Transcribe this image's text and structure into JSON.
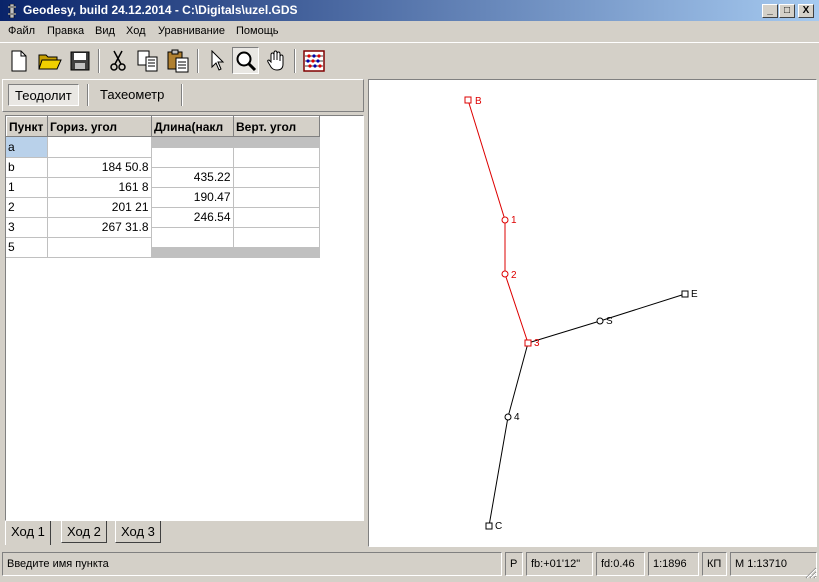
{
  "window": {
    "title": "Geodesy, build 24.12.2014 - C:\\Digitals\\uzel.GDS",
    "minimize": "_",
    "maximize": "□",
    "close": "X"
  },
  "menu": [
    "Файл",
    "Правка",
    "Вид",
    "Ход",
    "Уравнивание",
    "Помощь"
  ],
  "toolbar": {
    "buttons": [
      "new-file",
      "open-folder",
      "save",
      "cut",
      "copy",
      "paste",
      "pointer",
      "zoom-magnifier",
      "pan-hand",
      "calculator"
    ],
    "active": "zoom-magnifier"
  },
  "mode_tabs": {
    "items": [
      "Теодолит",
      "Тахеометр"
    ],
    "active": "Теодолит"
  },
  "grid": {
    "headers": [
      "Пункт",
      "Гориз. угол",
      "Длина(накл",
      "Верт. угол"
    ],
    "points": [
      {
        "name": "a",
        "angle": ""
      },
      {
        "name": "b",
        "angle": "184 50.8"
      },
      {
        "name": "1",
        "angle": "161 8"
      },
      {
        "name": "2",
        "angle": "201 21"
      },
      {
        "name": "3",
        "angle": "267 31.8"
      },
      {
        "name": "5",
        "angle": ""
      }
    ],
    "lengths": [
      "",
      "435.22",
      "190.47",
      "246.54",
      ""
    ]
  },
  "traverse_tabs": {
    "items": [
      "Ход 1",
      "Ход 2",
      "Ход 3"
    ],
    "active": "Ход 1"
  },
  "drawing": {
    "colors": {
      "active": "#dd0000",
      "inactive": "#000000"
    },
    "labels": [
      "B",
      "1",
      "2",
      "3",
      "S",
      "E",
      "4",
      "C"
    ]
  },
  "statusbar": {
    "message": "Введите имя пункта",
    "flag": "P",
    "fb": "fb:+01'12\"",
    "fd": "fd:0.46",
    "ratio": "1:1896",
    "kp": "КП",
    "scale": "M 1:13710"
  }
}
